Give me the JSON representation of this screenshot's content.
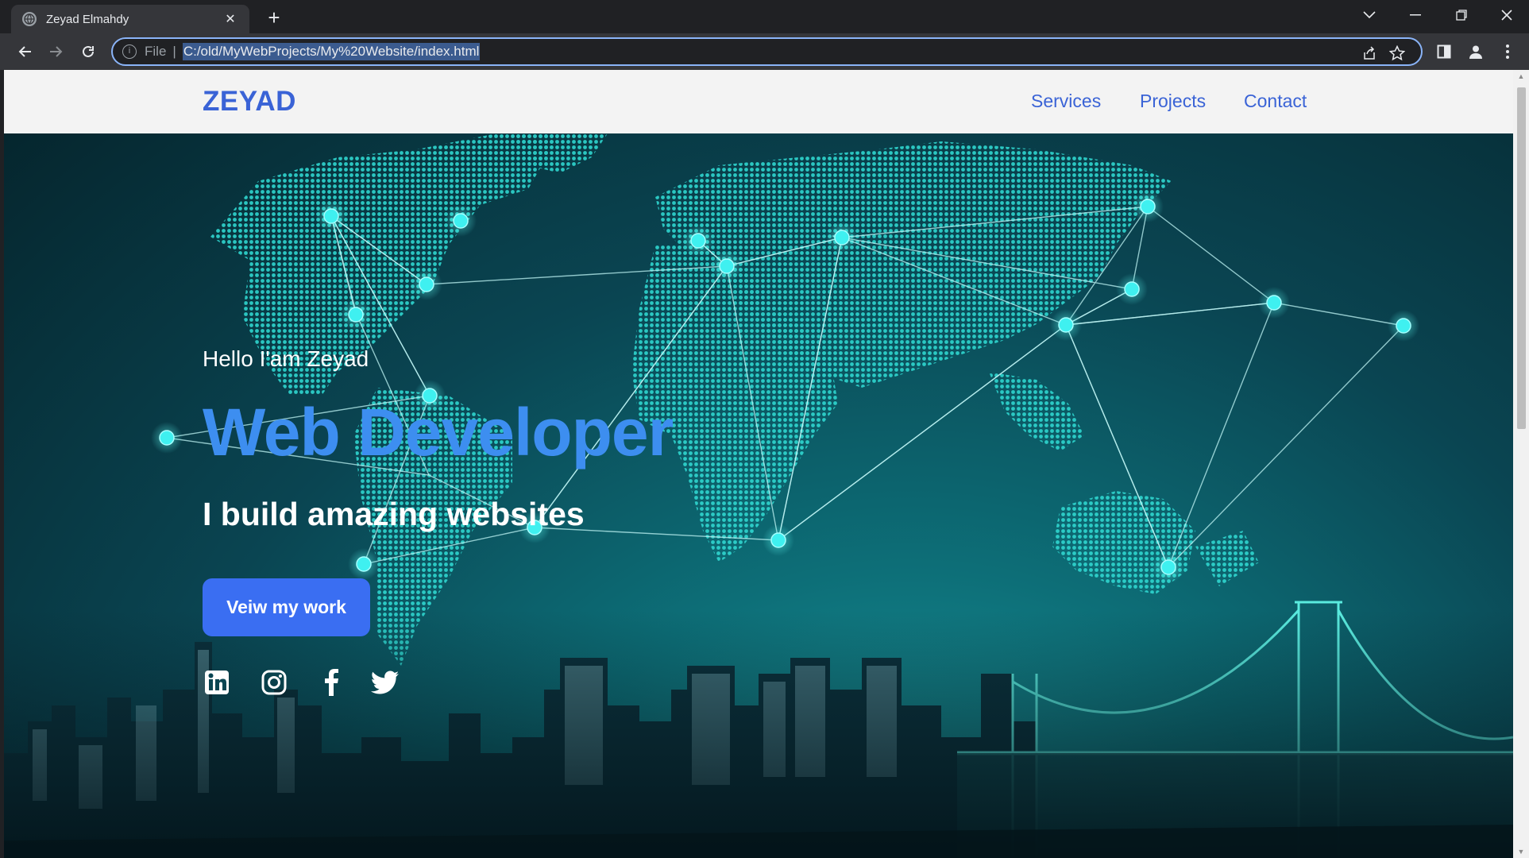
{
  "browser": {
    "tab_title": "Zeyad Elmahdy",
    "url_scheme": "File",
    "url_separator": "|",
    "url": "C:/old/MyWebProjects/My%20Website/index.html"
  },
  "site": {
    "logo": "ZEYAD",
    "nav": [
      "Services",
      "Projects",
      "Contact"
    ],
    "hero": {
      "greeting": "Hello I'am Zeyad",
      "title": "Web Developer",
      "tagline": "I build amazing websites",
      "cta_label": "Veiw my work"
    },
    "social_icons": [
      "linkedin-icon",
      "instagram-icon",
      "facebook-icon",
      "twitter-icon"
    ]
  },
  "colors": {
    "brand": "#3a63d6",
    "headline": "#3d8ef0",
    "cta": "#3a6ef2",
    "map_dots": "#2fd6cf",
    "nodes": "#3ff0f0"
  }
}
